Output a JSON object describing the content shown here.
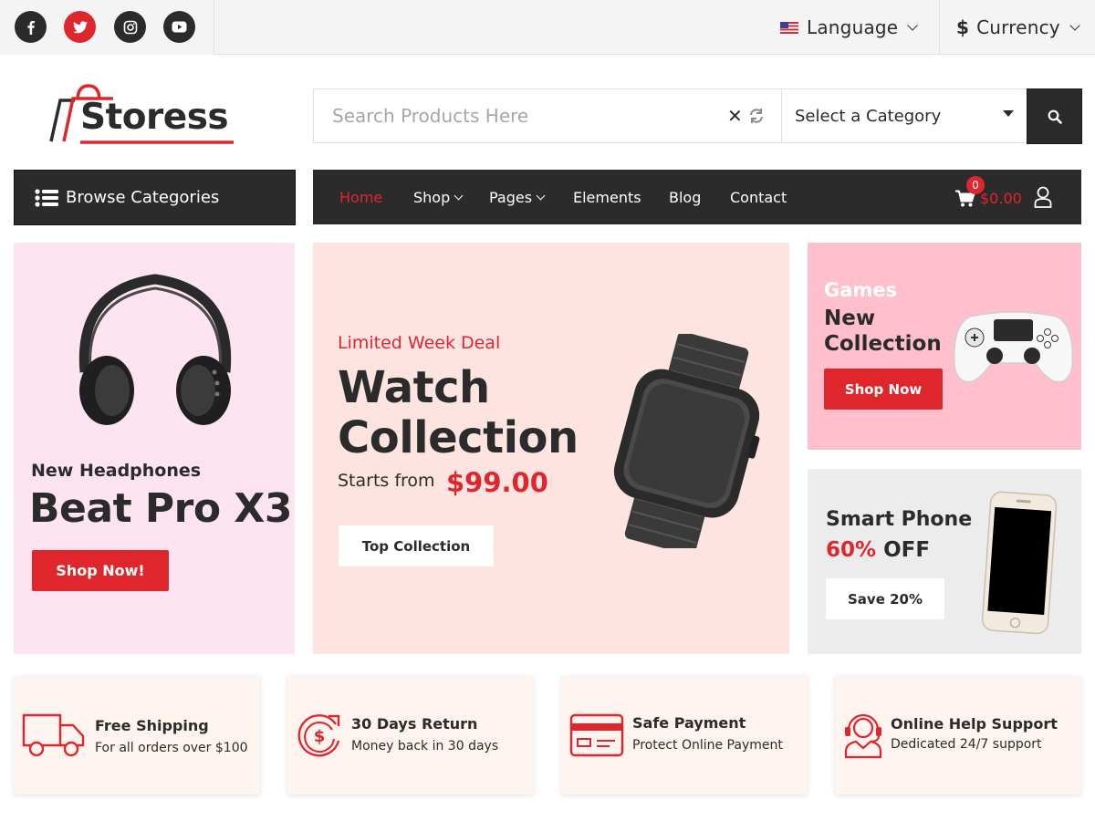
{
  "topbar": {
    "social": [
      "facebook-icon",
      "twitter-icon",
      "instagram-icon",
      "youtube-icon"
    ],
    "language_label": "Language",
    "currency_symbol": "$",
    "currency_label": "Currency"
  },
  "logo": {
    "text": "Storess"
  },
  "search": {
    "placeholder": "Search Products Here",
    "category_label": "Select a Category"
  },
  "nav": {
    "browse_label": "Browse Categories",
    "items": [
      {
        "label": "Home",
        "active": true
      },
      {
        "label": "Shop",
        "dropdown": true
      },
      {
        "label": "Pages",
        "dropdown": true
      },
      {
        "label": "Elements"
      },
      {
        "label": "Blog"
      },
      {
        "label": "Contact"
      }
    ],
    "cart_count": "0",
    "cart_total": "$0.00"
  },
  "banners": {
    "headphones": {
      "subtitle": "New Headphones",
      "title": "Beat Pro X3",
      "button": "Shop Now!"
    },
    "watch": {
      "deal": "Limited Week Deal",
      "title_line1": "Watch",
      "title_line2": "Collection",
      "starts_from": "Starts from",
      "price": "$99.00",
      "button": "Top Collection"
    },
    "games": {
      "label": "Games",
      "title_line1": "New",
      "title_line2": "Collection",
      "button": "Shop Now"
    },
    "phone": {
      "title": "Smart Phone",
      "percent": "60%",
      "off": " OFF",
      "button": "Save 20%"
    }
  },
  "features": [
    {
      "icon": "truck-icon",
      "title": "Free Shipping",
      "subtitle": "For all orders over $100"
    },
    {
      "icon": "return-icon",
      "title": "30 Days Return",
      "subtitle": "Money back in 30 days"
    },
    {
      "icon": "credit-card-icon",
      "title": "Safe Payment",
      "subtitle": "Protect Online Payment"
    },
    {
      "icon": "support-icon",
      "title": "Online Help Support",
      "subtitle": "Dedicated 24/7 support"
    }
  ],
  "colors": {
    "accent": "#e0262d",
    "dark": "#2b2b2b",
    "topbar_bg": "#f4f4f4"
  }
}
